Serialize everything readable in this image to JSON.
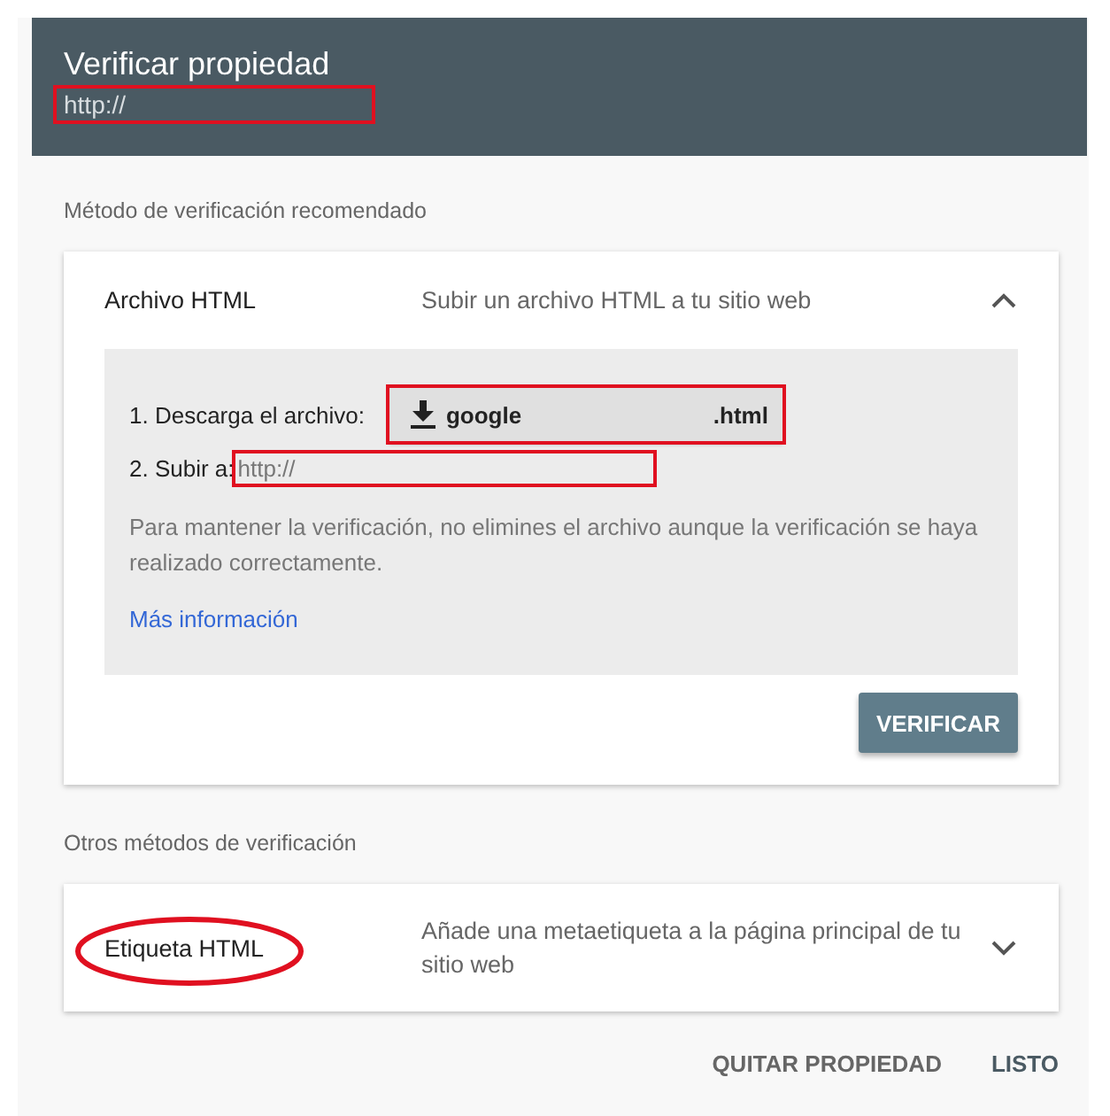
{
  "dialog": {
    "title": "Verificar propiedad",
    "url": "http://",
    "url_highlighted": true
  },
  "recommended": {
    "heading": "Método de verificación recomendado",
    "method": {
      "name": "Archivo HTML",
      "description": "Subir un archivo HTML a tu sitio web",
      "expanded": true,
      "step_1": {
        "label": "1. Descarga el archivo:",
        "file_name": "google",
        "file_ext": ".html",
        "highlighted": true
      },
      "step_2": {
        "label": "2. Subir a:",
        "url": "http://",
        "highlighted": true
      },
      "note": "Para mantener la verificación, no elimines el archivo aunque la verificación se haya realizado correctamente.",
      "link": "Más información",
      "button": "VERIFICAR"
    }
  },
  "others": {
    "heading": "Otros métodos de verificación",
    "methods": [
      {
        "name": "Etiqueta HTML",
        "description": "Añade una metaetiqueta a la página principal de tu sitio web",
        "expanded": false,
        "circled": true
      }
    ]
  },
  "actions": [
    "QUITAR PROPIEDAD",
    "LISTO"
  ]
}
